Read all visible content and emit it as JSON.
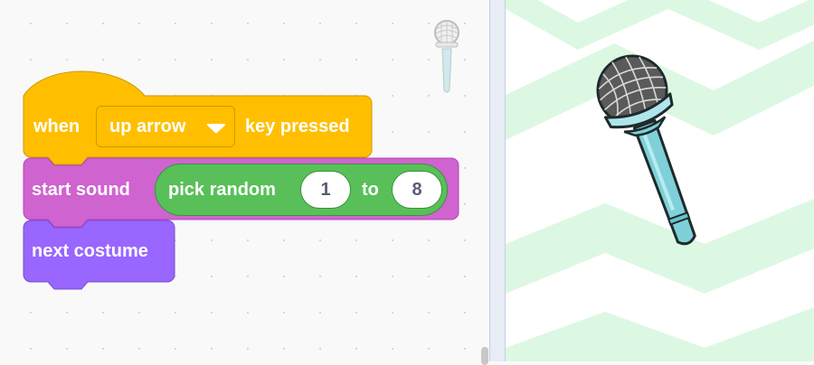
{
  "code_area": {
    "hat_block": {
      "prefix": "when",
      "key_dropdown": "up arrow",
      "suffix": "key pressed",
      "color": "#ffbf00"
    },
    "sound_block": {
      "label": "start sound",
      "color": "#cf63cf",
      "reporter": {
        "label": "pick random",
        "from": "1",
        "to_label": "to",
        "to": "8",
        "color": "#59c059"
      }
    },
    "looks_block": {
      "label": "next costume",
      "color": "#9966ff"
    },
    "sprite_thumbnail_icon": "microphone-icon"
  },
  "stage": {
    "backdrop": "green-chevron-backdrop",
    "sprite_icon": "microphone-icon",
    "colors": {
      "chevron": "#dcf8e2",
      "mic_body": "#7fd0d8",
      "mic_grille": "#555555"
    }
  }
}
